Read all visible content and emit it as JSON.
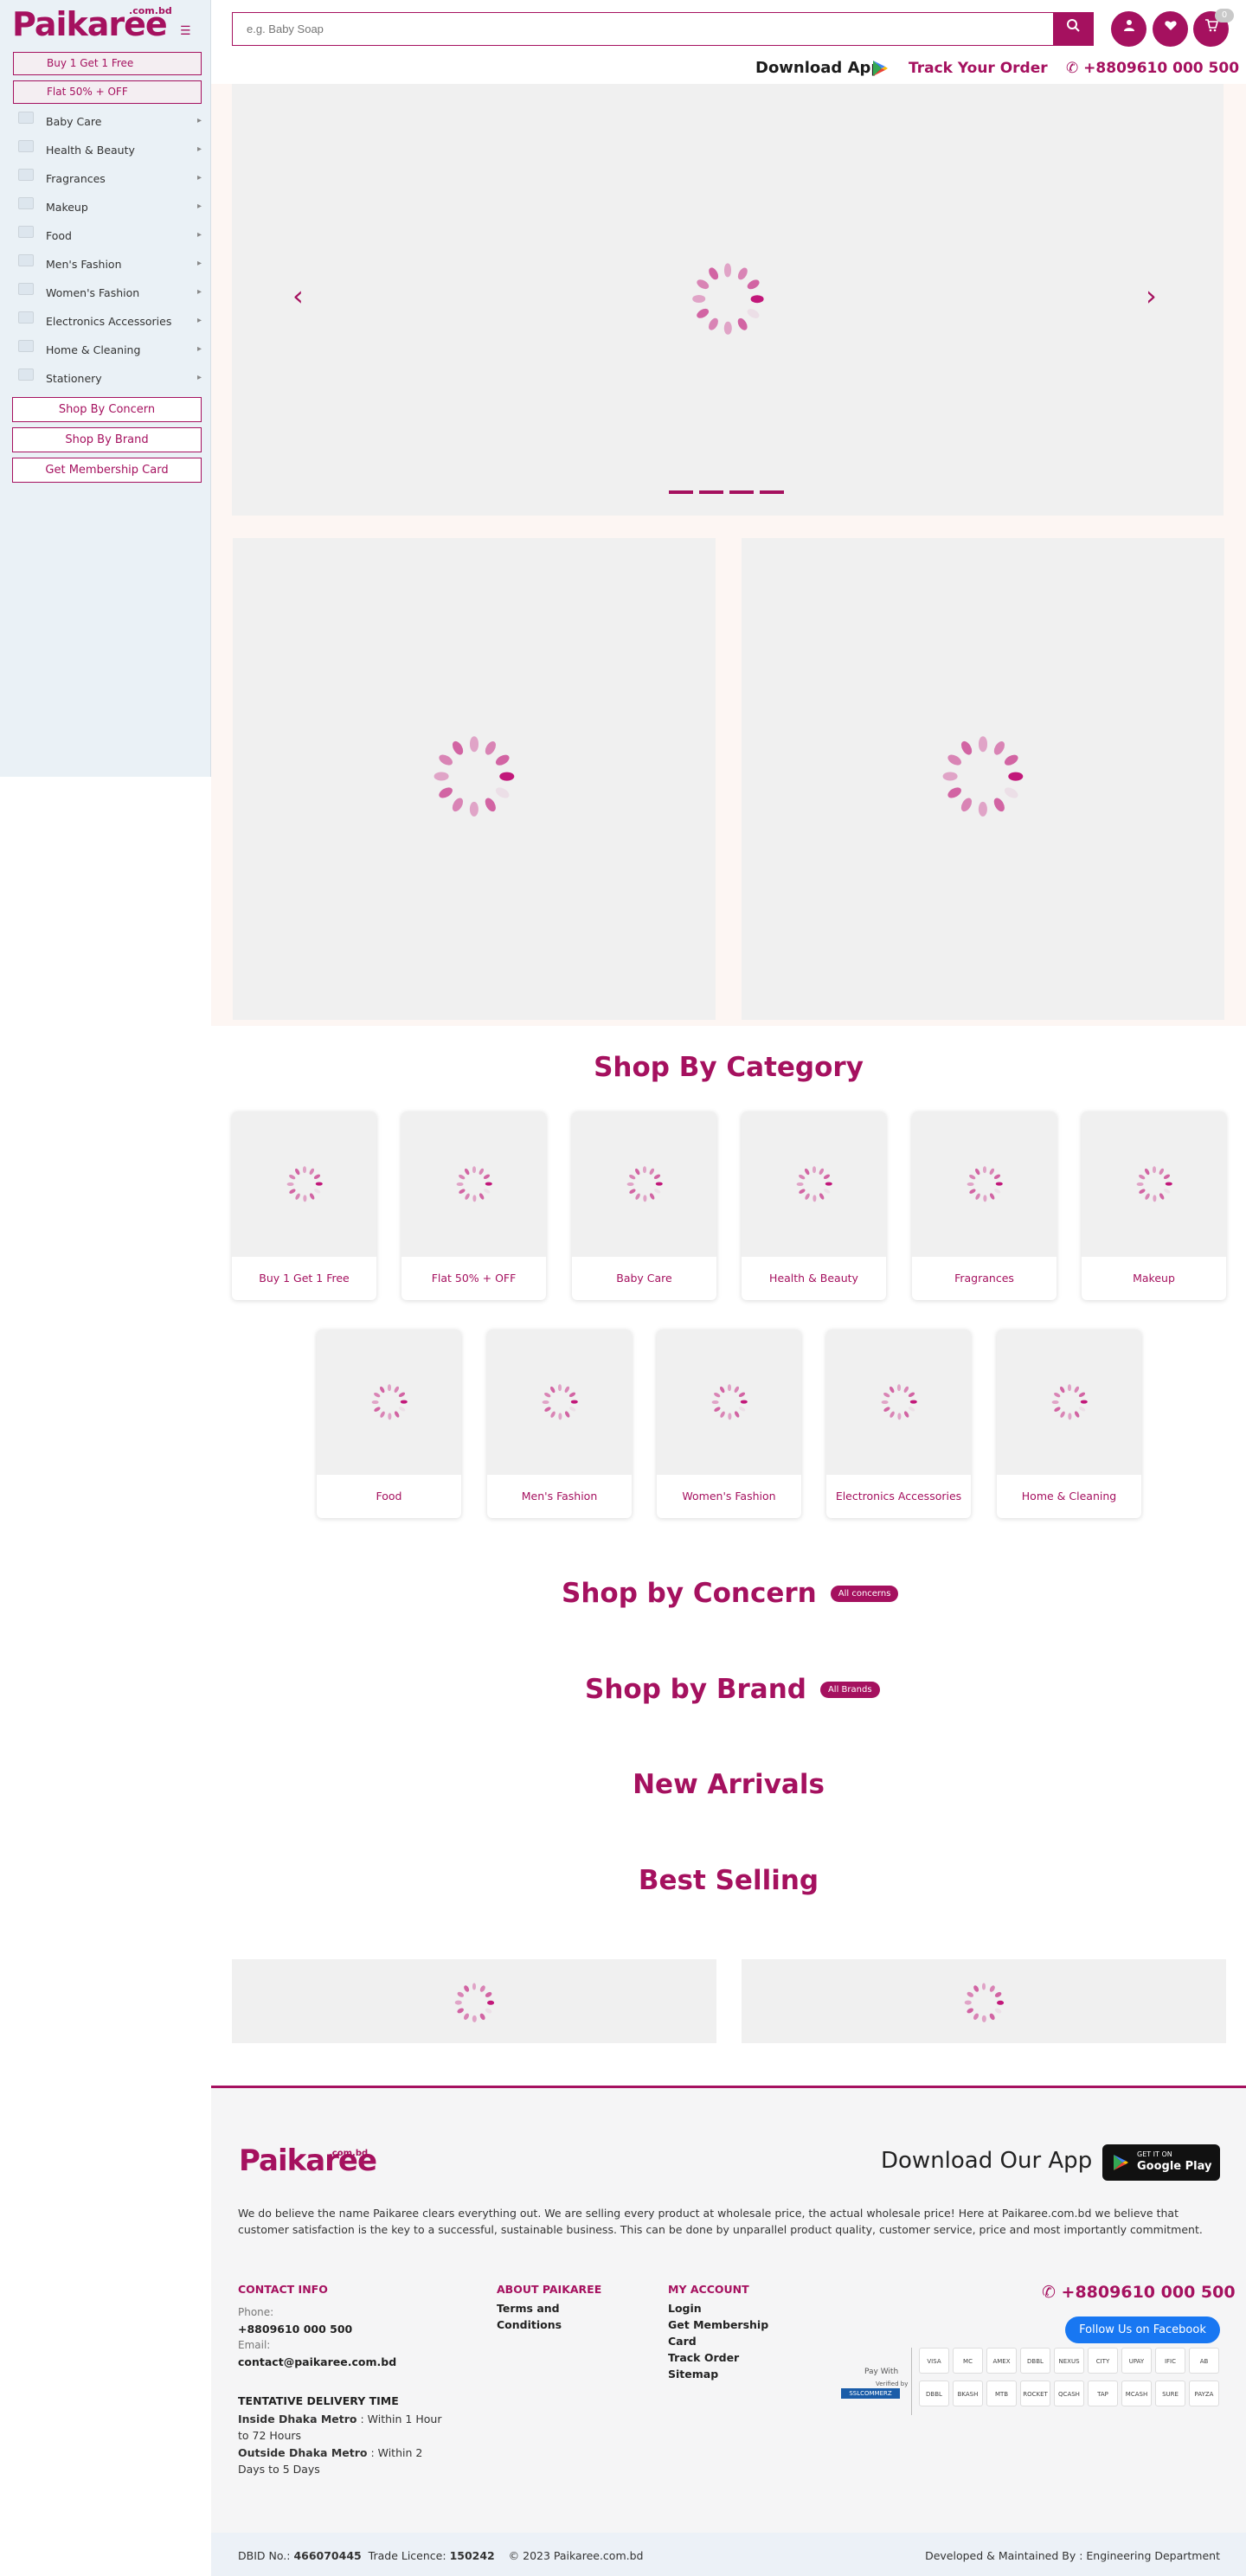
{
  "brand": {
    "name": "Paikaree",
    "suffix": ".com.bd"
  },
  "sidebar": {
    "promos": [
      "Buy 1 Get 1 Free",
      "Flat 50% + OFF"
    ],
    "categories": [
      "Baby Care",
      "Health & Beauty",
      "Fragrances",
      "Makeup",
      "Food",
      "Men's Fashion",
      "Women's Fashion",
      "Electronics Accessories",
      "Home & Cleaning",
      "Stationery"
    ],
    "buttons": [
      "Shop By Concern",
      "Shop By Brand",
      "Get Membership Card"
    ]
  },
  "header": {
    "search_placeholder": "e.g. Baby Soap",
    "cart_count": "0",
    "download_app": "Download App",
    "track_order": "Track Your Order",
    "phone": "+8809610 000 500"
  },
  "sections": {
    "shop_by_category": "Shop By Category",
    "shop_by_concern": "Shop by Concern",
    "all_concerns": "All concerns",
    "shop_by_brand": "Shop by Brand",
    "all_brands": "All Brands",
    "new_arrivals": "New Arrivals",
    "best_selling": "Best Selling"
  },
  "category_cards": [
    "Buy 1 Get 1 Free",
    "Flat 50% + OFF",
    "Baby Care",
    "Health & Beauty",
    "Fragrances",
    "Makeup",
    "Food",
    "Men's Fashion",
    "Women's Fashion",
    "Electronics Accessories",
    "Home & Cleaning"
  ],
  "footer": {
    "download_our_app": "Download Our App",
    "get_it_on": "GET IT ON",
    "google_play": "Google Play",
    "about": "We do believe the name Paikaree clears everything out. We are selling every product at wholesale price, the actual wholesale price! Here at Paikaree.com.bd we believe that customer satisfaction is the key to a successful, sustainable business. This can be done by unparallel product quality, customer service, price and most importantly commitment.",
    "contact_info": "CONTACT INFO",
    "phone_label": "Phone:",
    "phone": "+8809610 000 500",
    "email_label": "Email:",
    "email": "contact@paikaree.com.bd",
    "delivery_title": "TENTATIVE DELIVERY TIME",
    "inside_label": "Inside Dhaka Metro",
    "inside_text": " : Within 1 Hour to 72 Hours",
    "outside_label": "Outside Dhaka Metro",
    "outside_text": " : Within 2 Days to 5 Days",
    "about_title": "ABOUT PAIKAREE",
    "about_links": [
      "Terms and Conditions"
    ],
    "account_title": "MY ACCOUNT",
    "account_links": [
      "Login",
      "Get Membership Card",
      "Track Order",
      "Sitemap"
    ],
    "big_phone": "+8809610 000 500",
    "facebook": "Follow Us on Facebook",
    "pay_with": "Pay With",
    "verified_by": "Verified by",
    "sslcommerz": "SSLCOMMERZ",
    "pay_methods": [
      "VISA",
      "MC",
      "AMEX",
      "DBBL",
      "NEXUS",
      "CITY",
      "UPAY",
      "IFIC",
      "AB",
      "DBBL",
      "BKASH",
      "MTB",
      "ROCKET",
      "QCASH",
      "TAP",
      "MCASH",
      "SURE",
      "PAYZA"
    ],
    "dbid_label": "DBID No.:",
    "dbid": "466070445",
    "trade_label": "Trade Licence:",
    "trade": "150242",
    "copyright": "© 2023 Paikaree.com.bd",
    "developed": "Developed & Maintained By : Engineering Department"
  },
  "colors": {
    "brand": "#a5115f",
    "facebook": "#1877f2"
  }
}
